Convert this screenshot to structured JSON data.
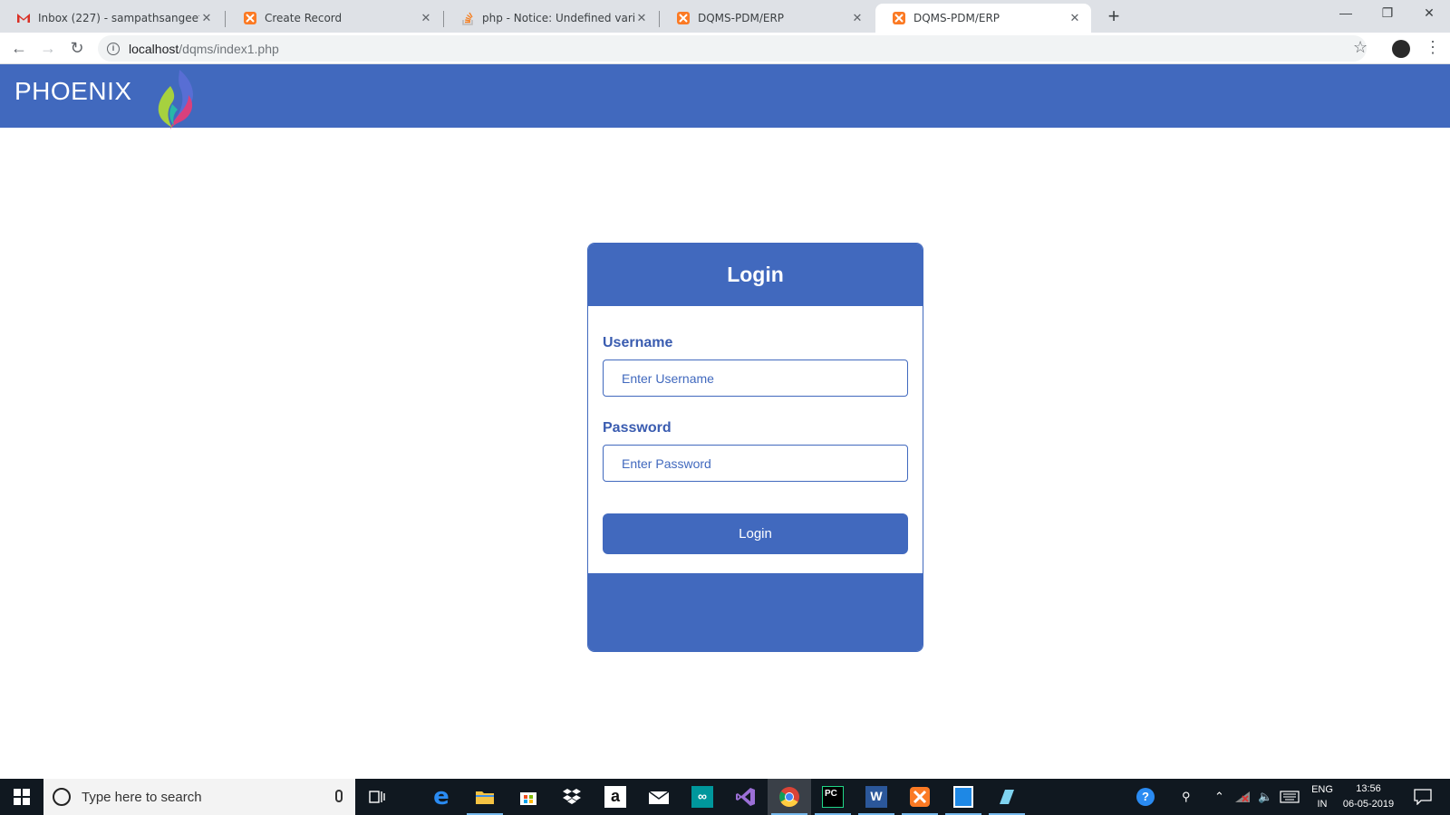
{
  "browser": {
    "tabs": [
      {
        "title": "Inbox (227) - sampathsangeeta1",
        "favicon": "gmail-icon"
      },
      {
        "title": "Create Record",
        "favicon": "xampp-icon"
      },
      {
        "title": "php - Notice: Undefined variable",
        "favicon": "stackoverflow-icon"
      },
      {
        "title": "DQMS-PDM/ERP",
        "favicon": "xampp-icon"
      },
      {
        "title": "DQMS-PDM/ERP",
        "favicon": "xampp-icon"
      }
    ],
    "active_tab": 4,
    "url_host": "localhost",
    "url_path": "/dqms/index1.php"
  },
  "app": {
    "brand": "PHOENIX",
    "accent_color": "#4169be"
  },
  "login": {
    "title": "Login",
    "username_label": "Username",
    "username_placeholder": "Enter Username",
    "password_label": "Password",
    "password_placeholder": "Enter Password",
    "submit_label": "Login"
  },
  "taskbar": {
    "search_placeholder": "Type here to search",
    "lang_top": "ENG",
    "lang_bottom": "IN",
    "time": "13:56",
    "date": "06-05-2019"
  }
}
